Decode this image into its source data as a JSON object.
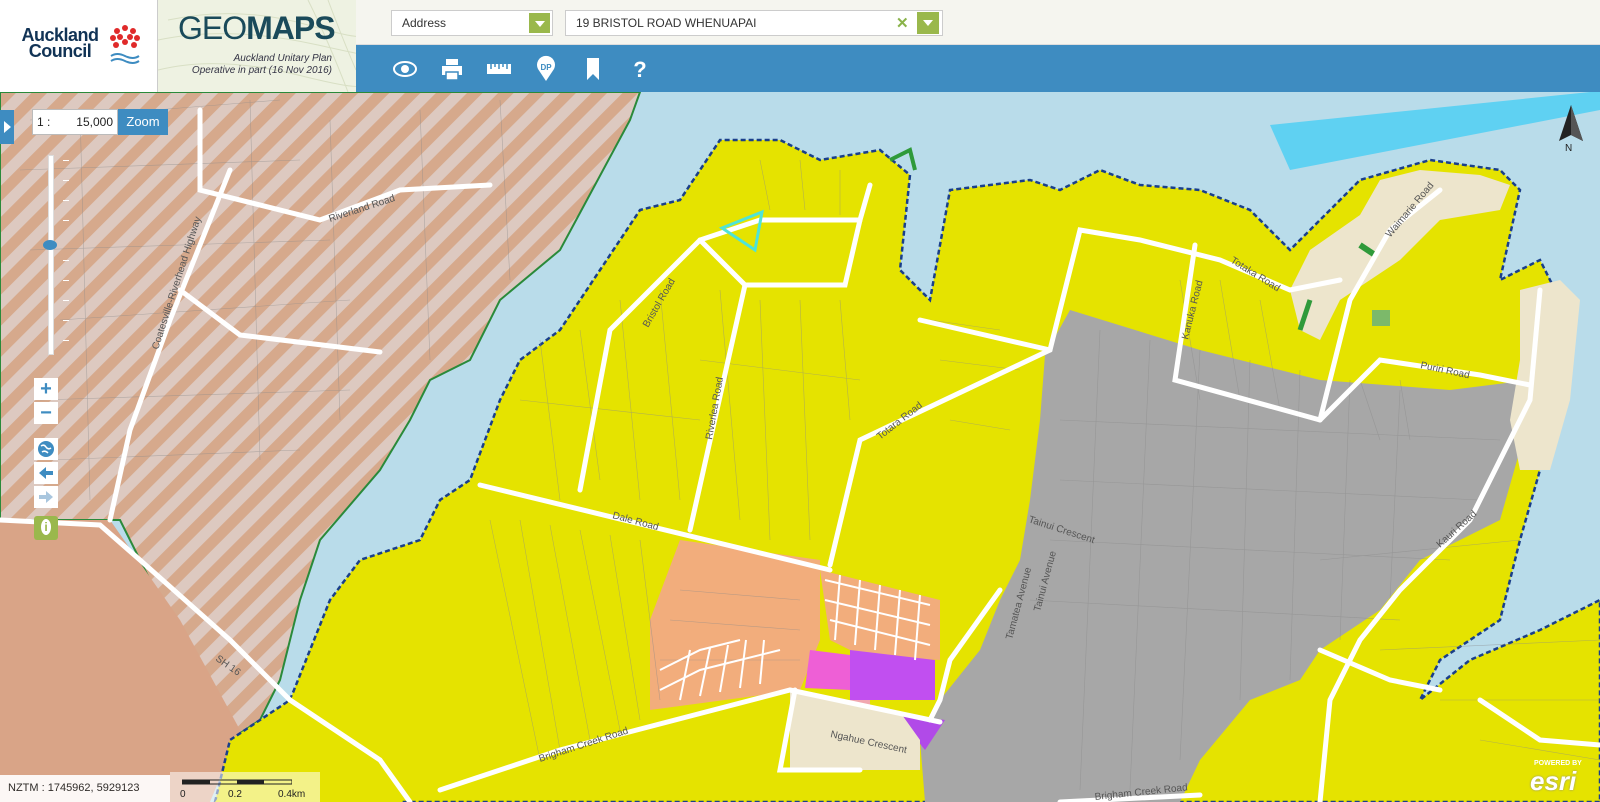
{
  "header": {
    "council_name": "Auckland Council",
    "app_title_light": "GEO",
    "app_title_bold": "MAPS",
    "plan_line1": "Auckland Unitary Plan",
    "plan_line2": "Operative in part (16 Nov 2016)"
  },
  "search": {
    "type_value": "Address",
    "query_value": "19 BRISTOL ROAD WHENUAPAI"
  },
  "toolbar": {
    "icons": [
      "eye-icon",
      "print-icon",
      "ruler-icon",
      "dp-pin-icon",
      "bookmark-icon",
      "help-icon"
    ],
    "dp_label": "DP",
    "help_label": "?"
  },
  "map_controls": {
    "scale_prefix": "1 :",
    "scale_value": "15,000",
    "zoom_label": "Zoom",
    "zoom_in": "+",
    "zoom_out": "−",
    "north_label": "N"
  },
  "road_labels": [
    "Riverland Road",
    "Coatesville-Riverhead Highway",
    "Bristol Road",
    "Riverlea Road",
    "Totara Road",
    "Dale Road",
    "Brigham Creek Road",
    "Ngahue Crescent",
    "Tamatea Avenue",
    "Tainui Avenue",
    "Tainui Crescent",
    "Kauri Road",
    "Kanuka Road",
    "Totaka Road",
    "Waimarie Road",
    "Puriri Road",
    "SH 16",
    "Brigham Creek Road"
  ],
  "footer": {
    "coords": "NZTM : 1745962, 5929123",
    "scale_0": "0",
    "scale_1": "0.2",
    "scale_2": "0.4km",
    "esri_powered": "POWERED BY",
    "esri_logo": "esri"
  },
  "colors": {
    "header_bar": "#3e8cc1",
    "accent_green": "#9ab84c",
    "water": "#b9dcea",
    "zone_yellow": "#e5e300",
    "zone_grey": "#a7a7a7",
    "zone_orange": "#f2ad7c",
    "zone_magenta": "#c14ff0",
    "rural_brown": "#d9a487"
  }
}
